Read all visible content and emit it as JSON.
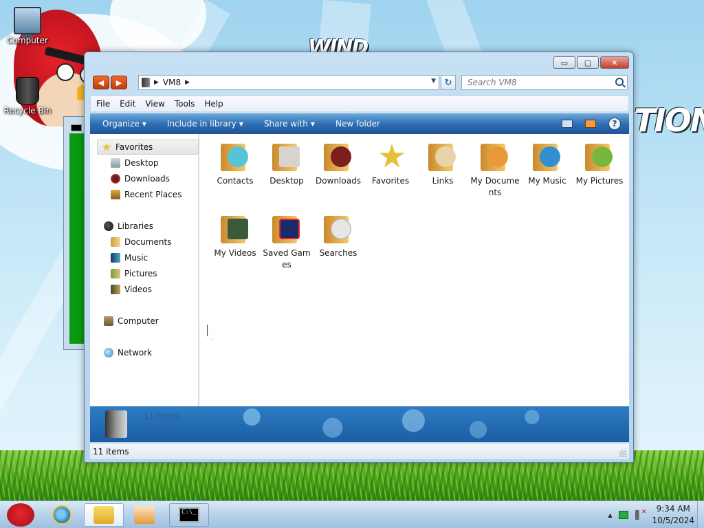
{
  "desktop": {
    "wallpaper_text_left": "WIND",
    "wallpaper_text_right": "TION",
    "icons": [
      {
        "label": "Computer",
        "icon": "computer-icon"
      },
      {
        "label": "Recycle Bin",
        "icon": "recycle-bin-icon"
      }
    ]
  },
  "explorer": {
    "address": {
      "path": "VM8",
      "dropdown": "▼",
      "separator": "▶"
    },
    "nav_buttons": {
      "back": "◀",
      "forward": "▶"
    },
    "window_buttons": {
      "minimize": "▭",
      "maximize": "▢",
      "close": "✕"
    },
    "search": {
      "placeholder": "Search VM8"
    },
    "menu": [
      "File",
      "Edit",
      "View",
      "Tools",
      "Help"
    ],
    "commands": [
      {
        "label": "Organize",
        "caret": "▼"
      },
      {
        "label": "Include in library",
        "caret": "▼"
      },
      {
        "label": "Share with",
        "caret": "▼"
      },
      {
        "label": "New folder",
        "caret": ""
      }
    ],
    "help_label": "?",
    "nav_pane": {
      "favorites": {
        "label": "Favorites",
        "items": [
          "Desktop",
          "Downloads",
          "Recent Places"
        ]
      },
      "libraries": {
        "label": "Libraries",
        "items": [
          "Documents",
          "Music",
          "Pictures",
          "Videos"
        ]
      },
      "computer": "Computer",
      "network": "Network"
    },
    "items": [
      {
        "label": "Contacts",
        "icon": "contacts-folder-icon",
        "color": "#58c3d6"
      },
      {
        "label": "Desktop",
        "icon": "desktop-folder-icon",
        "color": "#d9d3cf"
      },
      {
        "label": "Downloads",
        "icon": "downloads-folder-icon",
        "color": "#7a1e1e"
      },
      {
        "label": "Favorites",
        "icon": "favorites-folder-icon",
        "color": "#e4c03c"
      },
      {
        "label": "Links",
        "icon": "links-folder-icon",
        "color": "#e9d3a9"
      },
      {
        "label": "My Documents",
        "icon": "my-documents-folder-icon",
        "color": "#e89a3a"
      },
      {
        "label": "My Music",
        "icon": "my-music-folder-icon",
        "color": "#2f8fd0"
      },
      {
        "label": "My Pictures",
        "icon": "my-pictures-folder-icon",
        "color": "#77b83c"
      },
      {
        "label": "My Videos",
        "icon": "my-videos-folder-icon",
        "color": "#3a5a3a"
      },
      {
        "label": "Saved Games",
        "icon": "saved-games-folder-icon",
        "color": "#1a2a6a"
      },
      {
        "label": "Searches",
        "icon": "searches-folder-icon",
        "color": "#e6e6e6"
      }
    ],
    "details_pane": {
      "count_text": "11 items"
    },
    "status_bar": {
      "count_text": "11 items"
    }
  },
  "taskbar": {
    "console_text": "C:\\_",
    "clock": {
      "time": "9:34 AM",
      "date": "10/5/2024"
    },
    "tray_up": "▲"
  }
}
